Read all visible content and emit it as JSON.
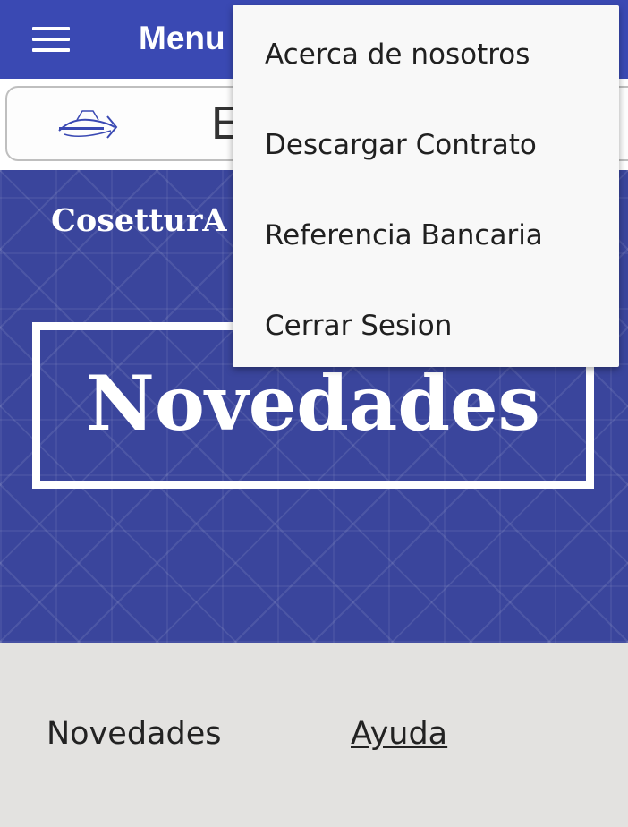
{
  "app_bar": {
    "title": "Menu",
    "menu_icon": "hamburger-menu-icon",
    "background_color": "#3a49b3"
  },
  "search_bar": {
    "visible_text": "E",
    "logo_icon": "cosettur-logo"
  },
  "banner": {
    "brand_text": "CosetturA",
    "title": "Novedades",
    "background_color": "#3a459c"
  },
  "footer": {
    "links": [
      {
        "label": "Novedades"
      },
      {
        "label": "Ayuda"
      }
    ],
    "background_color": "#e3e2e0"
  },
  "dropdown_menu": {
    "items": [
      {
        "label": "Acerca de nosotros"
      },
      {
        "label": "Descargar Contrato"
      },
      {
        "label": "Referencia Bancaria"
      },
      {
        "label": "Cerrar Sesion"
      }
    ]
  }
}
